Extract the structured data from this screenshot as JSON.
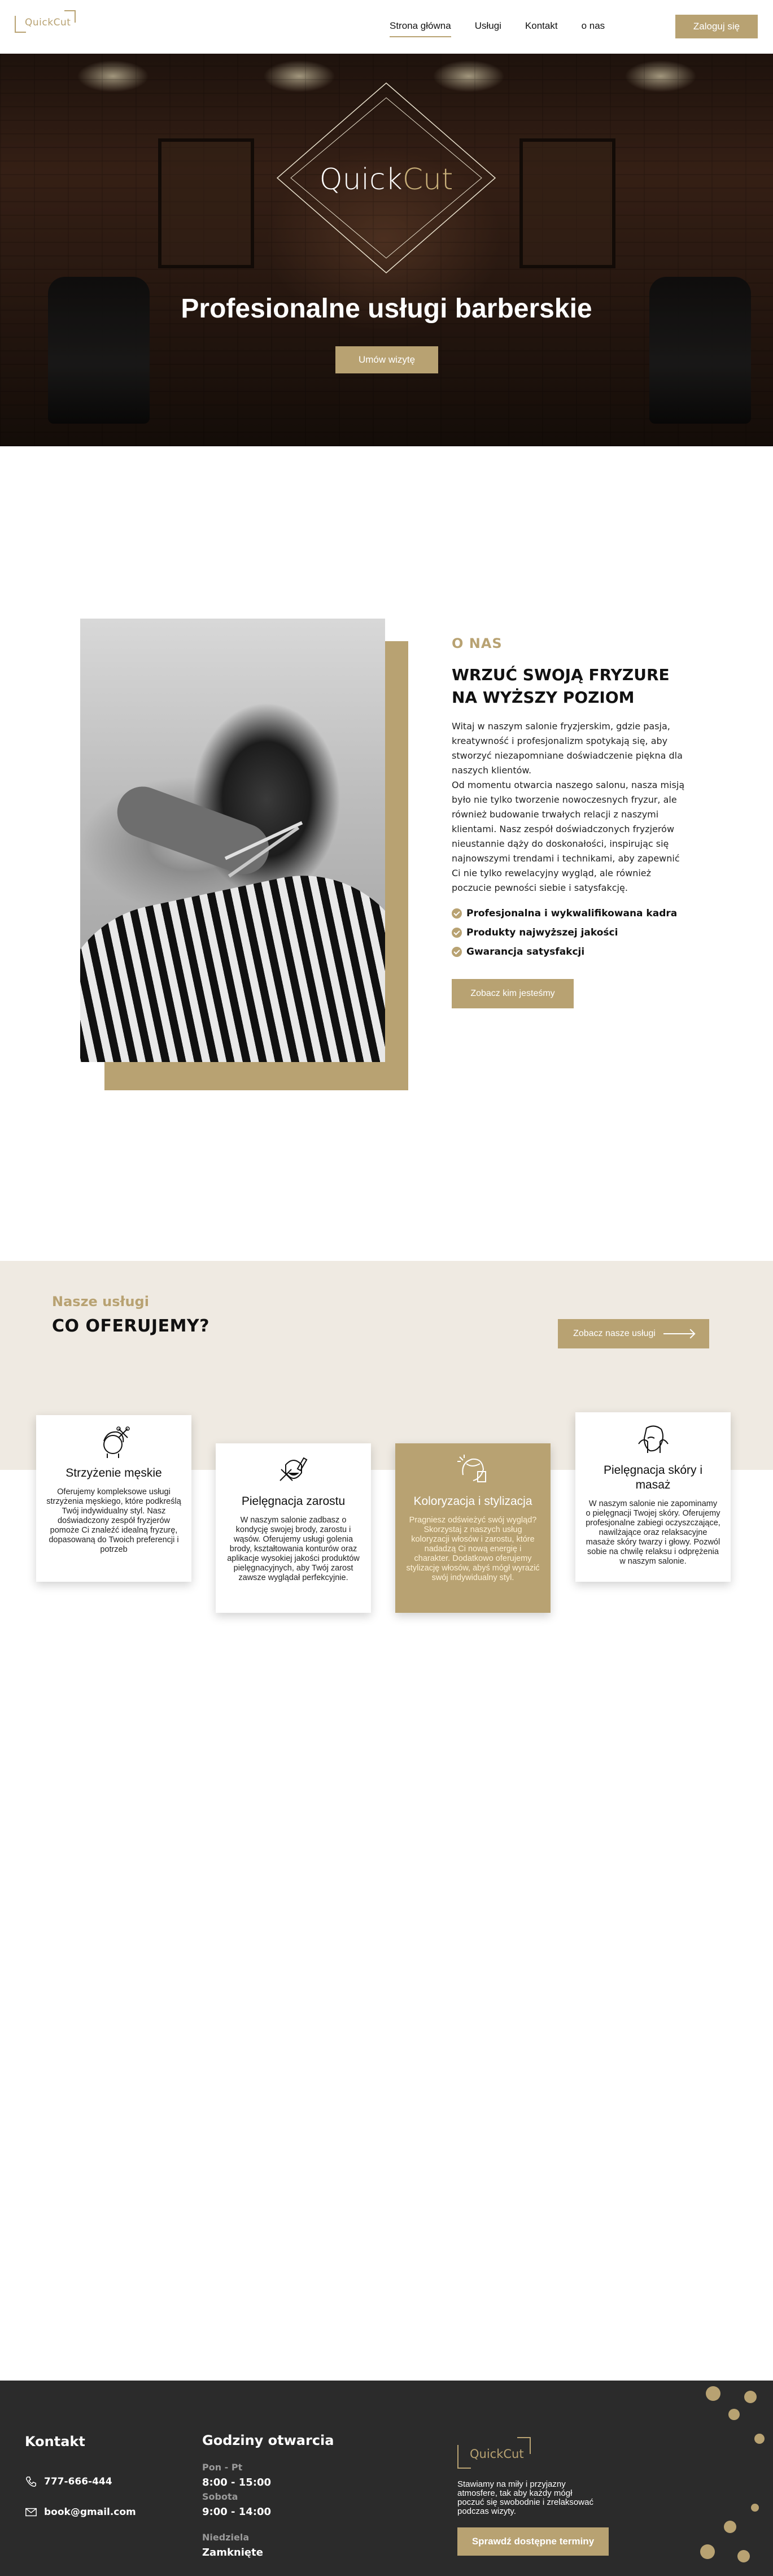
{
  "header": {
    "logo_prefix": "Quick",
    "logo_suffix": "Cut",
    "nav": [
      "Strona główna",
      "Usługi",
      "Kontakt",
      "o nas"
    ],
    "login_label": "Zaloguj się"
  },
  "hero": {
    "logo_prefix": "Quick",
    "logo_suffix": "Cut",
    "title": "Profesionalne usługi barberskie",
    "cta_label": "Umów wizytę"
  },
  "about": {
    "eyebrow": "O NAS",
    "heading_line1": "WRZUĆ SWOJĄ FRYZURE",
    "heading_line2": "NA WYŻSZY POZIOM",
    "paragraph1": "Witaj w naszym salonie fryzjerskim, gdzie pasja, kreatywność i profesjonalizm spotykają się, aby stworzyć niezapomniane doświadczenie piękna dla naszych klientów.",
    "paragraph2": "Od momentu otwarcia naszego salonu, nasza misją było nie tylko tworzenie nowoczesnych fryzur, ale również budowanie trwałych relacji z naszymi klientami. Nasz zespół doświadczonych fryzjerów nieustannie dąży do doskonałości, inspirując się najnowszymi trendami i technikami, aby zapewnić Ci nie tylko rewelacyjny wygląd, ale również poczucie pewności siebie i satysfakcję.",
    "features": [
      "Profesjonalna i wykwalifikowana kadra",
      "Produkty najwyższej jakości",
      "Gwarancja satysfakcji"
    ],
    "cta_label": "Zobacz kim jesteśmy"
  },
  "services": {
    "eyebrow": "Nasze usługi",
    "heading": "CO OFERUJEMY?",
    "cta_label": "Zobacz nasze usługi",
    "cards": [
      {
        "title": "Strzyżenie męskie",
        "icon": "barber-head-icon",
        "desc": "Oferujemy kompleksowe usługi strzyżenia męskiego, które podkreślą Twój indywidualny styl. Nasz doświadczony zespół fryzjerów pomoże Ci znaleźć idealną fryzurę, dopasowaną do Twoich preferencji i potrzeb"
      },
      {
        "title": "Pielęgnacja zarostu",
        "icon": "beard-shave-icon",
        "desc": "W naszym salonie zadbasz o kondycję swojej brody, zarostu i wąsów. Oferujemy usługi golenia brody, kształtowania konturów oraz aplikacje wysokiej jakości produktów pielęgnacyjnych, aby Twój zarost zawsze wyglądał perfekcyjnie."
      },
      {
        "title": "Koloryzacja i stylizacja",
        "icon": "hair-color-icon",
        "desc": "Pragniesz odświeżyć swój wygląd? Skorzystaj z naszych usług koloryzacji włosów i zarostu, które nadadzą Ci nową energię i charakter. Dodatkowo oferujemy stylizację włosów, abyś mógł wyrazić swój indywidualny styl."
      },
      {
        "title": "Pielęgnacja skóry i masaż",
        "icon": "face-massage-icon",
        "desc": "W naszym salonie nie zapominamy o pielęgnacji Twojej skóry. Oferujemy profesjonalne zabiegi oczyszczające, nawilżające oraz relaksacyjne masaże skóry twarzy i głowy. Pozwól sobie na chwilę relaksu i odprężenia w naszym salonie."
      }
    ]
  },
  "footer": {
    "contact_title": "Kontakt",
    "phone": "777-666-444",
    "email": "book@gmail.com",
    "hours_title": "Godziny otwarcia",
    "hours": [
      {
        "day": "Pon - Pt",
        "time": "8:00 - 15:00"
      },
      {
        "day": "Sobota",
        "time": "9:00 - 14:00"
      },
      {
        "day": "Niedziela",
        "time": "Zamknięte"
      }
    ],
    "logo_prefix": "Quick",
    "logo_suffix": "Cut",
    "slogan": "Stawiamy na miły i przyjazny atmosfere, tak aby każdy mógł poczuć się swobodnie i zrelaksować podczas wizyty.",
    "cta_label": "Sprawdź dostępne terminy"
  },
  "colors": {
    "accent": "#b8a272",
    "services_bg": "#efeae2",
    "footer_bg": "#2b2b2b"
  }
}
